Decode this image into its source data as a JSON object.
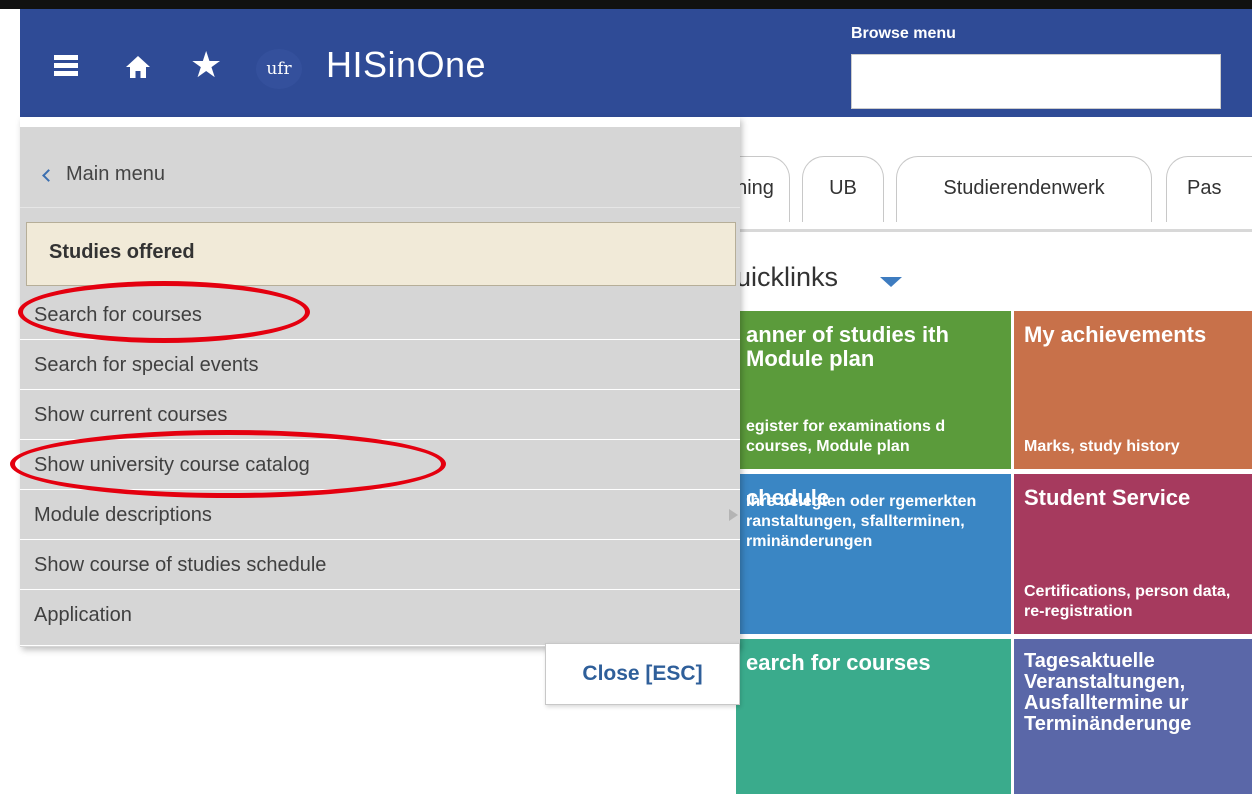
{
  "header": {
    "app_title": "HISinOne",
    "logo_text": "ufr",
    "browse_label": "Browse menu",
    "browse_value": "",
    "color": "#2f4b96"
  },
  "tabs": [
    {
      "label": "ning"
    },
    {
      "label": "UB"
    },
    {
      "label": "Studierendenwerk"
    },
    {
      "label": "Pas"
    }
  ],
  "quicklinks": {
    "title": "uicklinks",
    "tiles": [
      {
        "title": "anner of studies ith Module plan",
        "desc": "egister for examinations d courses, Module plan",
        "color": "#5b9b3b"
      },
      {
        "title": "My achievements",
        "desc": "Marks, study history",
        "color": "#c8714a"
      },
      {
        "title": "chedule",
        "desc": "Ihre belegten oder rgemerkten ranstaltungen, sfallterminen, rminänderungen",
        "color": "#3a86c4"
      },
      {
        "title": "Student Service",
        "desc": "Certifications, person data, re-registration",
        "color": "#a63a5e"
      },
      {
        "title": "earch for courses",
        "desc": "",
        "color": "#3aab8c"
      },
      {
        "title": "Tagesaktuelle Veranstaltungen, Ausfalltermine ur Terminänderunge",
        "desc": "",
        "color": "#5a67a8"
      }
    ]
  },
  "menu": {
    "back_label": "Main menu",
    "section_title": "Studies offered",
    "items": [
      {
        "label": "Search for courses",
        "has_submenu": false
      },
      {
        "label": "Search for special events",
        "has_submenu": false
      },
      {
        "label": "Show current courses",
        "has_submenu": false
      },
      {
        "label": "Show university course catalog",
        "has_submenu": false
      },
      {
        "label": "Module descriptions",
        "has_submenu": true
      },
      {
        "label": "Show course of studies schedule",
        "has_submenu": false
      },
      {
        "label": "Application",
        "has_submenu": false
      }
    ],
    "close_label": "Close [ESC]"
  },
  "annotation_color": "#e4000f"
}
